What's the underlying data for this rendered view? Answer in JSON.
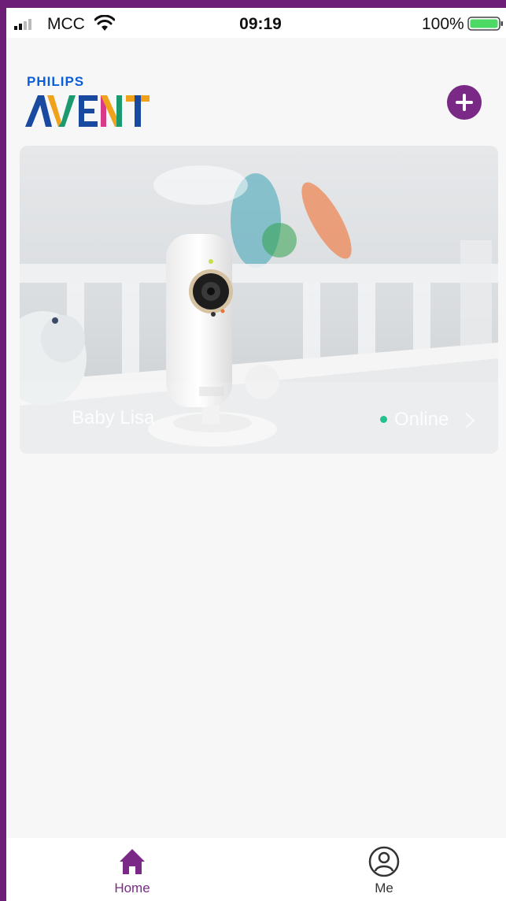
{
  "status_bar": {
    "carrier": "MCC",
    "time": "09:19",
    "battery": "100%",
    "signal_icon": "signal-bars-icon",
    "wifi_icon": "wifi-icon",
    "battery_icon": "battery-icon"
  },
  "header": {
    "brand_top": "PHILIPS",
    "brand_main": "AVENT",
    "add_icon": "plus-icon"
  },
  "device_card": {
    "name": "Baby Lisa",
    "status": "Online",
    "status_color": "#22c28c"
  },
  "tab_bar": {
    "tabs": [
      {
        "label": "Home",
        "icon": "home-icon",
        "active": true
      },
      {
        "label": "Me",
        "icon": "user-icon",
        "active": false
      }
    ]
  },
  "colors": {
    "accent": "#7a2a86",
    "background": "#f7f7f7",
    "frame": "#6d1f78"
  }
}
